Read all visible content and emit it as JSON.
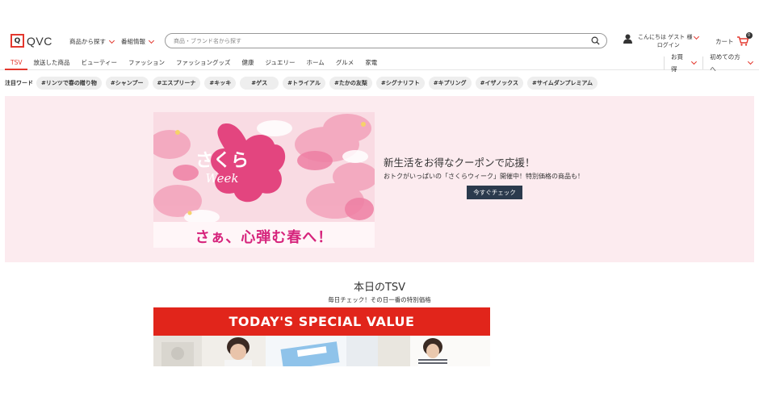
{
  "header": {
    "logo_text": "QVC",
    "logo_mark": "Q",
    "nav": [
      {
        "label": "商品から探す"
      },
      {
        "label": "番組情報"
      }
    ],
    "search": {
      "placeholder": "商品・ブランド名から探す",
      "value": ""
    },
    "user": {
      "greeting": "こんにちは ゲスト 様",
      "login": "ログイン"
    },
    "cart": {
      "label": "カート",
      "count": "0"
    }
  },
  "category_nav": {
    "items": [
      {
        "label": "TSV",
        "active": true
      },
      {
        "label": "放送した商品"
      },
      {
        "label": "ビューティー"
      },
      {
        "label": "ファッション"
      },
      {
        "label": "ファッショングッズ"
      },
      {
        "label": "健康"
      },
      {
        "label": "ジュエリー"
      },
      {
        "label": "ホーム"
      },
      {
        "label": "グルメ"
      },
      {
        "label": "家電"
      }
    ],
    "right": [
      {
        "label": "お買得"
      },
      {
        "label": "初めての方へ"
      }
    ]
  },
  "keywords": {
    "label": "注目ワード",
    "items": [
      "#リンツで春の贈り物",
      "#シャンプー",
      "#エスプリーナ",
      "#キッキ",
      "#ゲス",
      "#トライアル",
      "#たかの友梨",
      "#シグナリフト",
      "#キプリング",
      "#イザノックス",
      "#サイムダンプレミアム"
    ]
  },
  "banner": {
    "hero_title": "さくら",
    "hero_week": "Week",
    "hero_tagline": "さぁ、心弾む春へ！",
    "promo_title": "新生活をお得なクーポンで応援！",
    "promo_sub": "おトクがいっぱいの「さくらウィーク」開催中！特別価格の商品も！",
    "button": "今すぐチェック"
  },
  "tsv": {
    "title": "本日のTSV",
    "subtitle": "毎日チェック！その日一番の特別価格",
    "banner_text": "TODAY'S SPECIAL VALUE"
  },
  "colors": {
    "accent": "#e4382e",
    "banner_bg": "#fcebef",
    "button_bg": "#2b3a4d",
    "tsv_red": "#e1251b"
  }
}
